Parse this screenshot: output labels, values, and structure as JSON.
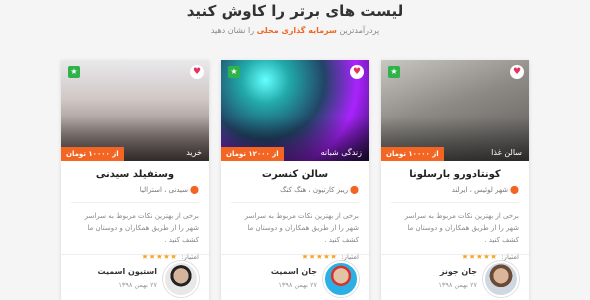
{
  "heading": {
    "title": "لیست های برتر را کاوش کنید",
    "subtitle_pre": "پردرآمدترین",
    "subtitle_highlight": "سرمایه گذاری محلی",
    "subtitle_post": "را نشان دهید"
  },
  "colors": {
    "accent": "#f26522",
    "star_badge": "#2db34a",
    "heart": "#e8315b",
    "rating_star": "#f5a623"
  },
  "cards": [
    {
      "title": "کونتادورو بارسلونا",
      "location": "شهر لوئیس ، ایرلند",
      "category": "سالن غذا",
      "price": "از ۱۰۰۰۰ تومان",
      "description": "برخی از بهترین نکات مربوط به سراسر شهر را از طریق همکاران و دوستان ما کشف کنید .",
      "rating_label": "امتیاز:",
      "stars": "★★★★★",
      "user_name": "جان جونز",
      "user_date": "۲۷ بهمن ۱۳۹۸"
    },
    {
      "title": "سالن کنسرت",
      "location": "ریبز کارتیون ، هنگ کنگ",
      "category": "زندگی شبانه",
      "price": "از ۱۲۰۰۰ تومان",
      "description": "برخی از بهترین نکات مربوط به سراسر شهر را از طریق همکاران و دوستان ما کشف کنید .",
      "rating_label": "امتیاز:",
      "stars": "★★★★★",
      "user_name": "جان اسمیت",
      "user_date": "۲۷ بهمن ۱۳۹۸"
    },
    {
      "title": "وستفیلد سیدنی",
      "location": "سیدنی ، استرالیا",
      "category": "خرید",
      "price": "از ۱۰۰۰۰ تومان",
      "description": "برخی از بهترین نکات مربوط به سراسر شهر را از طریق همکاران و دوستان ما کشف کنید .",
      "rating_label": "امتیاز:",
      "stars": "★★★★★",
      "user_name": "استیون اسمیت",
      "user_date": "۲۷ بهمن ۱۳۹۸"
    }
  ]
}
